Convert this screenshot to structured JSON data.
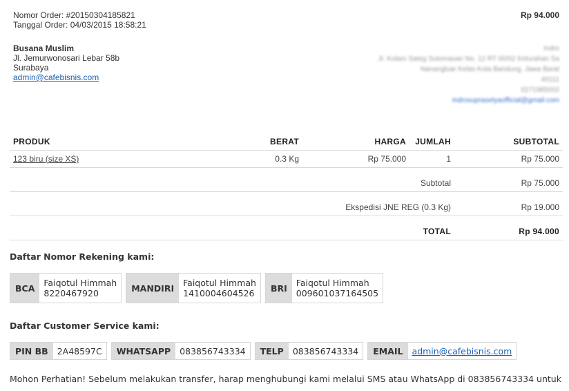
{
  "order": {
    "number": "Nomor Order: #20150304185821",
    "date": "Tanggal Order: 04/03/2015 18:58:21",
    "total_top": "Rp 94.000"
  },
  "customer": {
    "name": "Busana Muslim",
    "address1": "Jl. Jemurwonosari Lebar 58b",
    "city": "Surabaya",
    "email": "admin@cafebisnis.com"
  },
  "store_blurred": {
    "line1": "Indro",
    "line2": "Jl. Kolam Sateg Sutomasan No. 12 RT 00/02 Kelurahan Sa",
    "line3": "Nanangluar Kelas Kota Bandung, Jawa Barat",
    "line4": "40111",
    "line5": "0271985002",
    "line6": "indrosuprasetyaofficial@gmail.com"
  },
  "table": {
    "headers": {
      "product": "PRODUK",
      "weight": "BERAT",
      "price": "HARGA",
      "qty": "JUMLAH",
      "subtotal": "SUBTOTAL"
    },
    "rows": [
      {
        "product": "123 biru (size XS)",
        "weight": "0.3 Kg",
        "price": "Rp 75.000",
        "qty": "1",
        "subtotal": "Rp 75.000"
      }
    ],
    "summary": {
      "subtotal_label": "Subtotal",
      "subtotal_value": "Rp 75.000",
      "shipping_label": "Ekspedisi JNE REG (0.3 Kg)",
      "shipping_value": "Rp 19.000",
      "total_label": "TOTAL",
      "total_value": "Rp 94.000"
    }
  },
  "banks": {
    "heading": "Daftar Nomor Rekening kami:",
    "items": [
      {
        "bank": "BCA",
        "holder": "Faiqotul Himmah",
        "number": "8220467920"
      },
      {
        "bank": "MANDIRI",
        "holder": "Faiqotul Himmah",
        "number": "1410004604526"
      },
      {
        "bank": "BRI",
        "holder": "Faiqotul Himmah",
        "number": "009601037164505"
      }
    ]
  },
  "contacts": {
    "heading": "Daftar Customer Service kami:",
    "items": [
      {
        "label": "PIN BB",
        "value": "2A48597C"
      },
      {
        "label": "WHATSAPP",
        "value": "083856743334"
      },
      {
        "label": "TELP",
        "value": "083856743334"
      },
      {
        "label": "EMAIL",
        "value": "admin@cafebisnis.com"
      }
    ]
  },
  "note": "Mohon Perhatian! Sebelum melakukan transfer, harap menghubungi kami melalui SMS atau WhatsApp di 083856743334 untuk"
}
